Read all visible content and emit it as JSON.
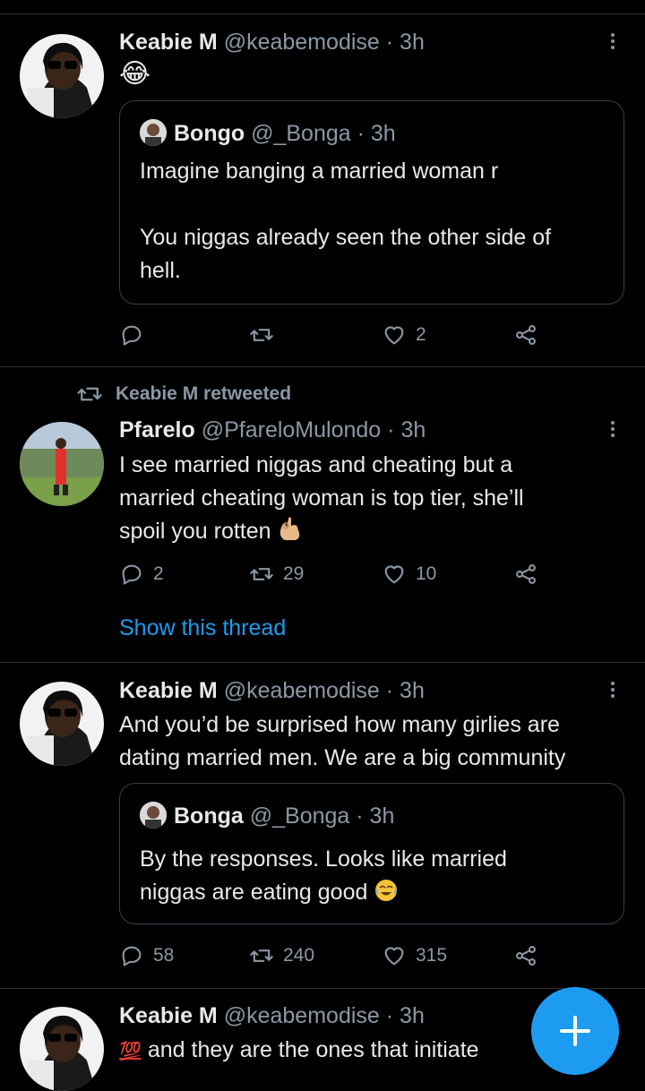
{
  "tweets": [
    {
      "name": "Keabie M",
      "handle": "@keabemodise",
      "time": "· 3h",
      "text": "😂",
      "quote": {
        "name": "Bongo",
        "handle": "@_Bonga",
        "time": "· 3h",
        "lines": [
          "Imagine banging a married woman r",
          "",
          "You niggas already seen the other side of",
          "hell."
        ]
      },
      "actions": {
        "replies": "",
        "retweets": "",
        "likes": "2"
      }
    },
    {
      "retweeted_by": "Keabie M retweeted",
      "name": "Pfarelo",
      "handle": "@PfareloMulondo",
      "time": "· 3h",
      "lines": [
        "I see married niggas and cheating but a",
        "married cheating woman is top tier, she’ll",
        "spoil you rotten"
      ],
      "actions": {
        "replies": "2",
        "retweets": "29",
        "likes": "10"
      },
      "show_thread": "Show this thread"
    },
    {
      "name": "Keabie M",
      "handle": "@keabemodise",
      "time": "· 3h",
      "lines": [
        "And you’d be surprised how many girlies are",
        "dating married men. We are a big community"
      ],
      "quote": {
        "name": "Bonga",
        "handle": "@_Bonga",
        "time": "· 3h",
        "lines": [
          "By the responses. Looks like married",
          "niggas are eating good"
        ]
      },
      "actions": {
        "replies": "58",
        "retweets": "240",
        "likes": "315"
      }
    },
    {
      "name": "Keabie M",
      "handle": "@keabemodise",
      "time": "· 3h",
      "text_prefix": "💯",
      "text": "and they are the ones that initiate"
    }
  ],
  "fab": {
    "icon": "plus-icon"
  },
  "colors": {
    "accent": "#1d9bf0",
    "muted": "#8b98a5",
    "divider": "#2f3336"
  }
}
